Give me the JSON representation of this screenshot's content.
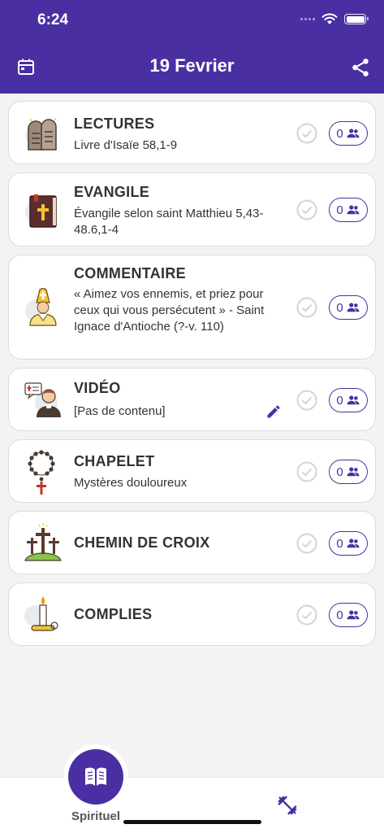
{
  "status_bar": {
    "time": "6:24"
  },
  "header": {
    "title": "19 Fevrier",
    "calendar_icon": "calendar-icon",
    "share_icon": "share-icon",
    "background": "#4a2fa3"
  },
  "cards": [
    {
      "title": "LECTURES",
      "subtitle": "Livre d'Isaïe  58,1-9",
      "count": "0",
      "icon": "tablets-icon"
    },
    {
      "title": "EVANGILE",
      "subtitle": "Évangile selon saint Matthieu 5,43-48.6,1-4",
      "count": "0",
      "icon": "bible-icon"
    },
    {
      "title": "COMMENTAIRE",
      "subtitle": "« Aimez vos ennemis, et priez pour ceux qui vous persécutent » - Saint Ignace d'Antioche (?-v. 110)",
      "count": "0",
      "icon": "bishop-icon"
    },
    {
      "title": "VIDÉO",
      "subtitle": "[Pas de contenu]",
      "count": "0",
      "icon": "priest-video-icon"
    },
    {
      "title": "CHAPELET",
      "subtitle": "Mystères douloureux",
      "count": "0",
      "icon": "rosary-icon"
    },
    {
      "title": "CHEMIN DE CROIX",
      "subtitle": "",
      "count": "0",
      "icon": "crosses-icon"
    },
    {
      "title": "COMPLIES",
      "subtitle": "",
      "count": "0",
      "icon": "candle-icon"
    }
  ],
  "bottom_nav": {
    "active_label": "Spirituel",
    "active_icon": "book-icon",
    "other_icon": "dumbbell-icon"
  },
  "colors": {
    "accent": "#4a2fa3",
    "check": "#d4d4d4"
  }
}
